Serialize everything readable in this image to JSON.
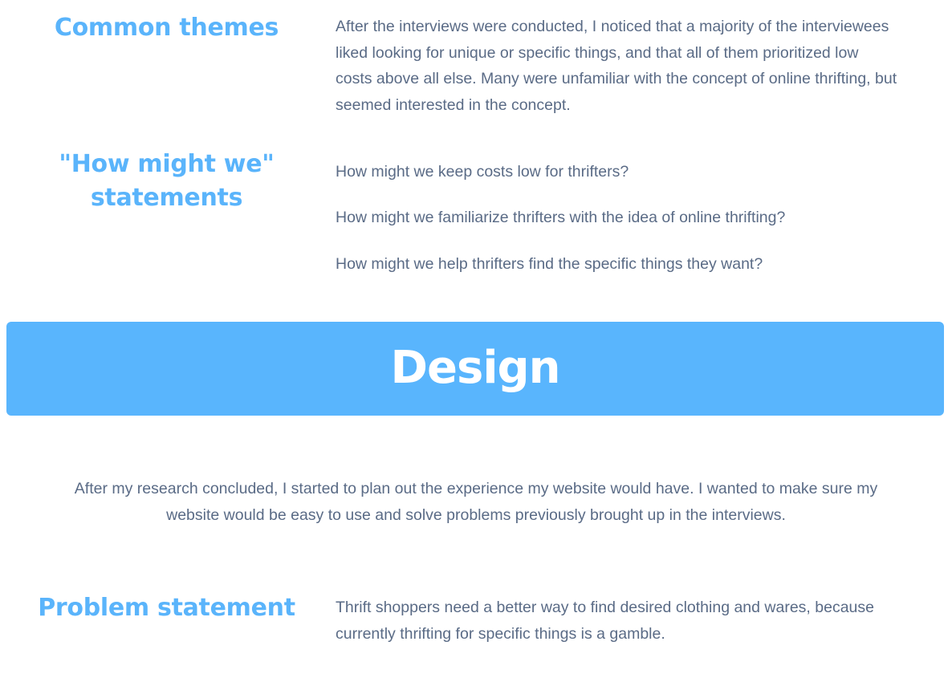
{
  "common_themes": {
    "heading": "Common themes",
    "body": "After the interviews were conducted, I noticed that a majority of the interviewees liked looking for unique or specific things, and that all of them prioritized low costs above all else. Many were unfamiliar with the concept of online thrifting, but seemed interested in the concept."
  },
  "how_might_we": {
    "heading": "\"How might we\" statements",
    "statements": [
      "How might we keep costs low for thrifters?",
      "How might we familiarize thrifters with the idea of online thrifting?",
      "How might we help thrifters find the specific things they want?"
    ]
  },
  "design": {
    "title": "Design",
    "banner_color": "#59b5fd",
    "intro": "After my research concluded, I started to plan out the experience my website would have. I wanted to make sure my website would be easy to use and solve problems previously brought up in the interviews."
  },
  "problem_statement": {
    "heading": "Problem statement",
    "body": "Thrift shoppers need a better way to find desired clothing and wares, because currently thrifting for specific things is a gamble."
  },
  "colors": {
    "heading": "#5ab4fb",
    "text": "#5a6b86"
  }
}
